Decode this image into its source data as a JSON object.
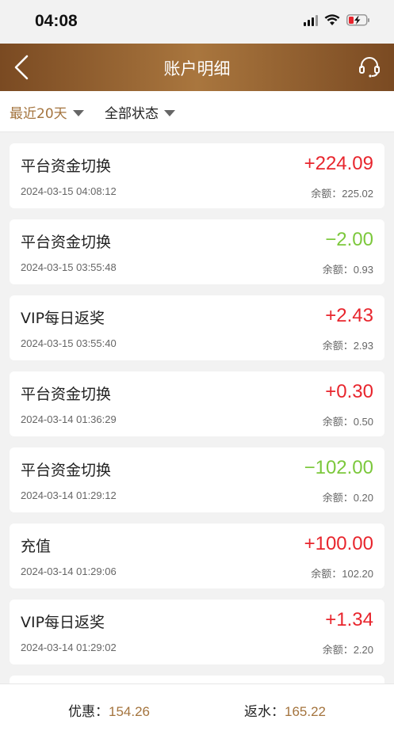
{
  "status_bar": {
    "time": "04:08"
  },
  "nav": {
    "title": "账户明细",
    "gradient": [
      "#7a4a22",
      "#a9763e"
    ]
  },
  "filters": {
    "period": "最近20天",
    "status": "全部状态"
  },
  "transactions": [
    {
      "title": "平台资金切换",
      "time": "2024-03-15 04:08:12",
      "amount": "+224.09",
      "balance": "余额：225.02",
      "sign": "pos"
    },
    {
      "title": "平台资金切换",
      "time": "2024-03-15 03:55:48",
      "amount": "−2.00",
      "balance": "余额：0.93",
      "sign": "neg"
    },
    {
      "title": "VIP每日返奖",
      "time": "2024-03-15 03:55:40",
      "amount": "+2.43",
      "balance": "余额：2.93",
      "sign": "pos"
    },
    {
      "title": "平台资金切换",
      "time": "2024-03-14 01:36:29",
      "amount": "+0.30",
      "balance": "余额：0.50",
      "sign": "pos"
    },
    {
      "title": "平台资金切换",
      "time": "2024-03-14 01:29:12",
      "amount": "−102.00",
      "balance": "余额：0.20",
      "sign": "neg"
    },
    {
      "title": "充值",
      "time": "2024-03-14 01:29:06",
      "amount": "+100.00",
      "balance": "余额：102.20",
      "sign": "pos"
    },
    {
      "title": "VIP每日返奖",
      "time": "2024-03-14 01:29:02",
      "amount": "+1.34",
      "balance": "余额：2.20",
      "sign": "pos"
    }
  ],
  "footer": {
    "discount_label": "优惠：",
    "discount_value": "154.26",
    "rebate_label": "返水：",
    "rebate_value": "165.22"
  },
  "colors": {
    "accent": "#a4743e",
    "positive": "#e8252d",
    "negative": "#7cc83c"
  }
}
